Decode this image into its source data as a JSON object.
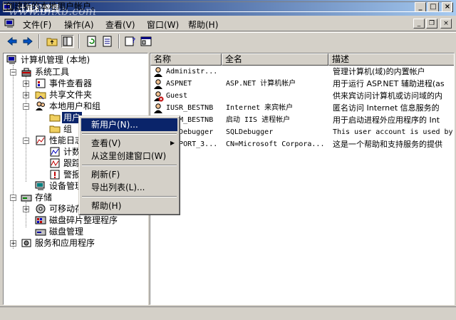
{
  "window": {
    "title": "计算机管理",
    "watermark": "www.bnxb.com",
    "minimize": "_",
    "maximize": "□",
    "close": "×",
    "inner_minimize": "_",
    "inner_restore": "❐",
    "inner_close": "×"
  },
  "menubar": {
    "items": [
      "文件(F)",
      "操作(A)",
      "查看(V)",
      "窗口(W)",
      "帮助(H)"
    ]
  },
  "toolbar": {
    "buttons": [
      "back-icon",
      "forward-icon",
      "up-folder-icon",
      "show-tree-icon",
      "refresh-icon",
      "export-icon",
      "help-icon",
      "properties-icon"
    ]
  },
  "tree": {
    "root": "计算机管理 (本地)",
    "system_tools": "系统工具",
    "event_viewer": "事件查看器",
    "shared_folders": "共享文件夹",
    "local_users": "本地用户和组",
    "users": "用户",
    "groups": "组",
    "perf_logs": "性能日志和警报",
    "counter_logs": "计数器日志",
    "trace_logs": "跟踪日志",
    "alerts": "警报",
    "device_manager": "设备管理器",
    "storage": "存储",
    "removable": "可移动存储",
    "defrag": "磁盘碎片整理程序",
    "disk_mgmt": "磁盘管理",
    "services": "服务和应用程序"
  },
  "list": {
    "columns": [
      "名称",
      "全名",
      "描述"
    ],
    "rows": [
      {
        "name": "Administr...",
        "full": "",
        "desc": "管理计算机(域)的内置帐户"
      },
      {
        "name": "ASPNET",
        "full": "ASP.NET 计算机帐户",
        "desc": "用于运行 ASP.NET 辅助进程(as"
      },
      {
        "name": "Guest",
        "full": "",
        "desc": "供来宾访问计算机或访问域的内"
      },
      {
        "name": "IUSR_BESTNB",
        "full": "Internet 来宾帐户",
        "desc": "匿名访问 Internet 信息服务的"
      },
      {
        "name": "IWAM_BESTNB",
        "full": "启动 IIS 进程帐户",
        "desc": "用于启动进程外应用程序的 Int"
      },
      {
        "name": "SQLDebugger",
        "full": "SQLDebugger",
        "desc": "This user account is used by"
      },
      {
        "name": "SUPPORT_3...",
        "full": "CN=Microsoft Corpora...",
        "desc": "这是一个帮助和支持服务的提供"
      }
    ]
  },
  "context_menu": {
    "new_user": "新用户(N)...",
    "view": "查看(V)",
    "new_window": "从这里创建窗口(W)",
    "refresh": "刷新(F)",
    "export": "导出列表(L)...",
    "help": "帮助(H)"
  },
  "status": {
    "text": "创建新的本地用户帐户。"
  },
  "colors": {
    "title_start": "#0a246a",
    "title_end": "#a6caf0",
    "highlight": "#0a246a",
    "face": "#d4d0c8"
  }
}
